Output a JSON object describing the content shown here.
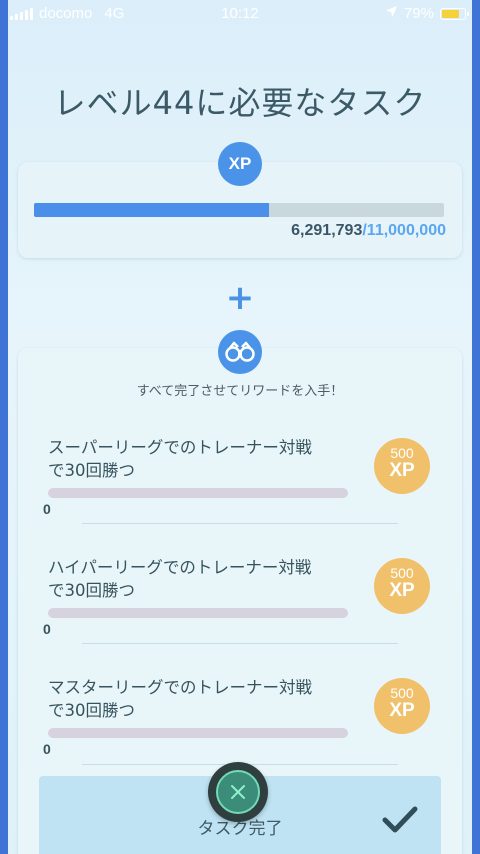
{
  "status_bar": {
    "carrier": "docomo",
    "network": "4G",
    "time": "10:12",
    "battery_percent": "79%",
    "icons": [
      "signal-icon",
      "location-arrow-icon",
      "battery-icon"
    ]
  },
  "title": "レベル44に必要なタスク",
  "xp": {
    "badge": "XP",
    "current": "6,291,793",
    "separator": "/",
    "total": "11,000,000",
    "progress_fraction": 0.572
  },
  "plus": "+",
  "tasks_card": {
    "badge_icon": "binoculars-icon",
    "subtitle": "すべて完了させてリワードを入手！",
    "tasks": [
      {
        "line1": "スーパーリーグでのトレーナー対戦",
        "line2": "で30回勝つ",
        "progress": "0",
        "reward_amount": "500",
        "reward_unit": "XP"
      },
      {
        "line1": "ハイパーリーグでのトレーナー対戦",
        "line2": "で30回勝つ",
        "progress": "0",
        "reward_amount": "500",
        "reward_unit": "XP"
      },
      {
        "line1": "マスターリーグでのトレーナー対戦",
        "line2": "で30回勝つ",
        "progress": "0",
        "reward_amount": "500",
        "reward_unit": "XP"
      }
    ]
  },
  "complete": {
    "label": "タスク完了",
    "check_icon": "checkmark-icon",
    "close_icon": "close-icon"
  },
  "colors": {
    "accent_blue": "#4a93e8",
    "reward_gold": "#f0c06a",
    "close_green": "#3b8c78"
  }
}
